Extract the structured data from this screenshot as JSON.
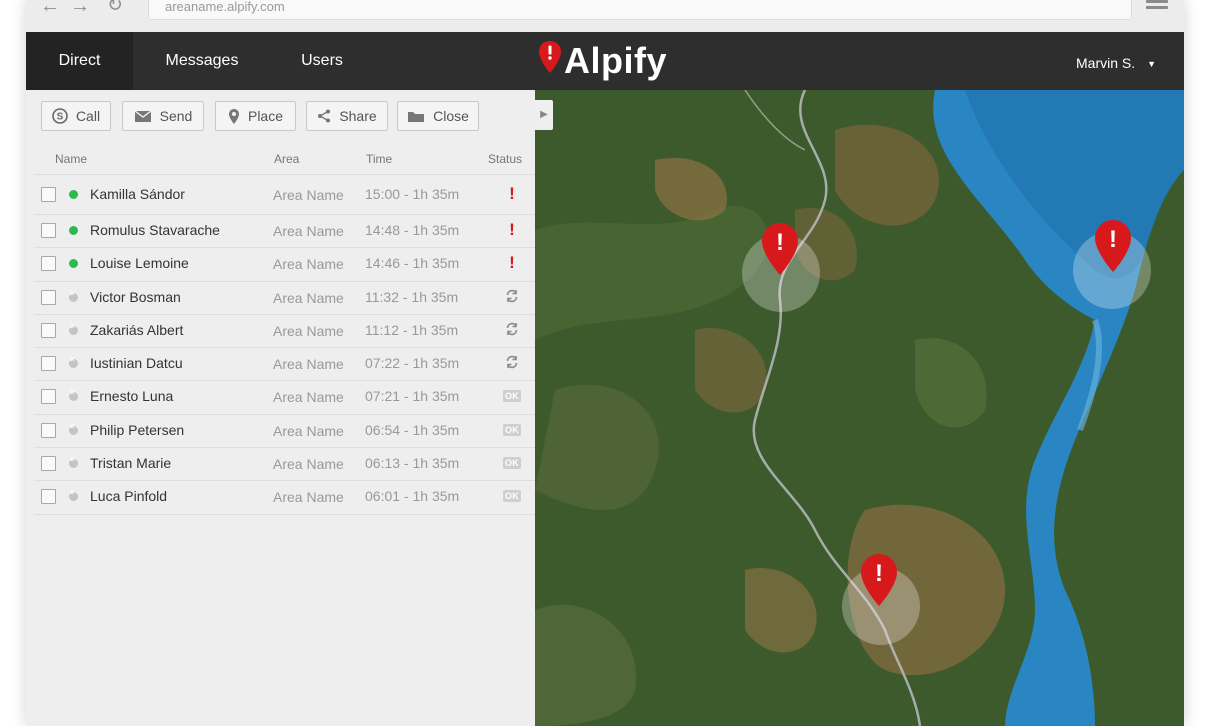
{
  "browser": {
    "url": "areaname.alpify.com",
    "back_glyph": "←",
    "forward_glyph": "→",
    "reload_glyph": "↻"
  },
  "nav": {
    "tabs": [
      "Direct",
      "Messages",
      "Users"
    ],
    "active_tab": "Direct",
    "logo_text": "Alpify",
    "user_name": "Marvin S.",
    "user_caret": "▼"
  },
  "toolbar": {
    "call": "Call",
    "send": "Send",
    "place": "Place",
    "share": "Share",
    "close": "Close"
  },
  "table": {
    "headers": {
      "name": "Name",
      "area": "Area",
      "time": "Time",
      "status": "Status"
    },
    "rows": [
      {
        "name": "Kamilla Sándor",
        "area": "Area Name",
        "time": "15:00 - 1h 35m",
        "presence": "online",
        "status": "alert"
      },
      {
        "name": "Romulus Stavarache",
        "area": "Area Name",
        "time": "14:48 - 1h 35m",
        "presence": "online",
        "status": "alert"
      },
      {
        "name": "Louise Lemoine",
        "area": "Area Name",
        "time": "14:46 - 1h 35m",
        "presence": "online",
        "status": "alert"
      },
      {
        "name": "Victor Bosman",
        "area": "Area Name",
        "time": "11:32 - 1h 35m",
        "presence": "offline",
        "status": "sync"
      },
      {
        "name": "Zakariás Albert",
        "area": "Area Name",
        "time": "11:12 - 1h 35m",
        "presence": "offline",
        "status": "sync"
      },
      {
        "name": "Iustinian Datcu",
        "area": "Area Name",
        "time": "07:22 - 1h 35m",
        "presence": "offline",
        "status": "sync"
      },
      {
        "name": "Ernesto Luna",
        "area": "Area Name",
        "time": "07:21 - 1h 35m",
        "presence": "offline",
        "status": "ok"
      },
      {
        "name": "Philip Petersen",
        "area": "Area Name",
        "time": "06:54 - 1h 35m",
        "presence": "offline",
        "status": "ok"
      },
      {
        "name": "Tristan Marie",
        "area": "Area Name",
        "time": "06:13 - 1h 35m",
        "presence": "offline",
        "status": "ok"
      },
      {
        "name": "Luca Pinfold",
        "area": "Area Name",
        "time": "06:01 - 1h 35m",
        "presence": "offline",
        "status": "ok"
      }
    ],
    "status_glyphs": {
      "alert": "!",
      "sync": "⟳",
      "ok": "OK"
    }
  },
  "map": {
    "collapse_glyph": "▶",
    "marker_glyph": "!",
    "colors": {
      "forest": "#3d5a2d",
      "water": "#2a86c2",
      "marker_red": "#d7191c",
      "brand_dark": "#2e2e2e",
      "online_green": "#2dbb4f"
    }
  }
}
